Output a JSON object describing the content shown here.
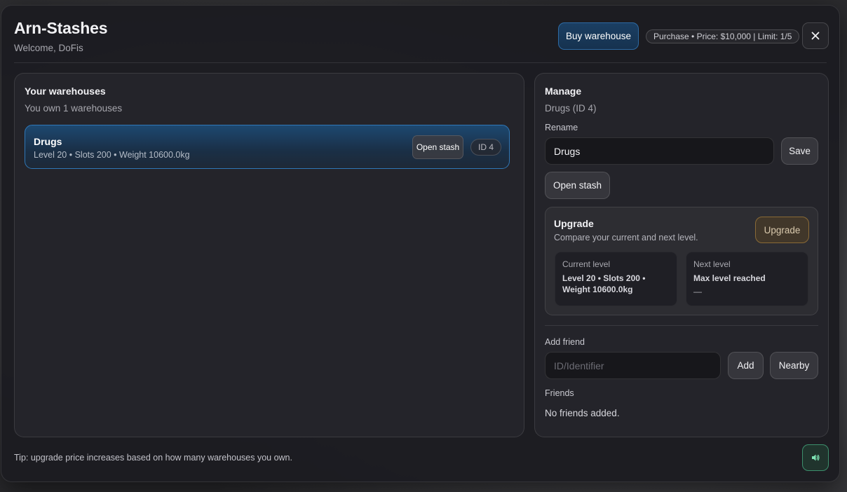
{
  "header": {
    "title": "Arn-Stashes",
    "welcome": "Welcome, DoFis",
    "buy_label": "Buy warehouse",
    "price_info": "Purchase • Price: $10,000 | Limit: 1/5",
    "close_icon": "close-icon"
  },
  "warehouses": {
    "title": "Your warehouses",
    "subtitle": "You own 1 warehouses",
    "items": [
      {
        "name": "Drugs",
        "meta": "Level 20 • Slots 200 • Weight 10600.0kg",
        "open_label": "Open stash",
        "id_label": "ID 4"
      }
    ]
  },
  "manage": {
    "title": "Manage",
    "selected": "Drugs (ID 4)",
    "rename_label": "Rename",
    "rename_value": "Drugs",
    "save_label": "Save",
    "open_stash_label": "Open stash",
    "upgrade": {
      "title": "Upgrade",
      "subtitle": "Compare your current and next level.",
      "button_label": "Upgrade",
      "current": {
        "label": "Current level",
        "value": "Level 20 • Slots 200 • Weight 10600.0kg"
      },
      "next": {
        "label": "Next level",
        "value": "Max level reached",
        "extra": "—"
      }
    },
    "add_friend_label": "Add friend",
    "add_friend_placeholder": "ID/Identifier",
    "add_label": "Add",
    "nearby_label": "Nearby",
    "friends_label": "Friends",
    "friends_empty": "No friends added."
  },
  "footer": {
    "tip": "Tip: upgrade price increases based on how many warehouses you own.",
    "sound_icon": "speaker-icon"
  },
  "colors": {
    "accent_blue": "#2f78b8",
    "upgrade_gold": "#8a6a36",
    "sound_green": "#3c8f6c"
  }
}
